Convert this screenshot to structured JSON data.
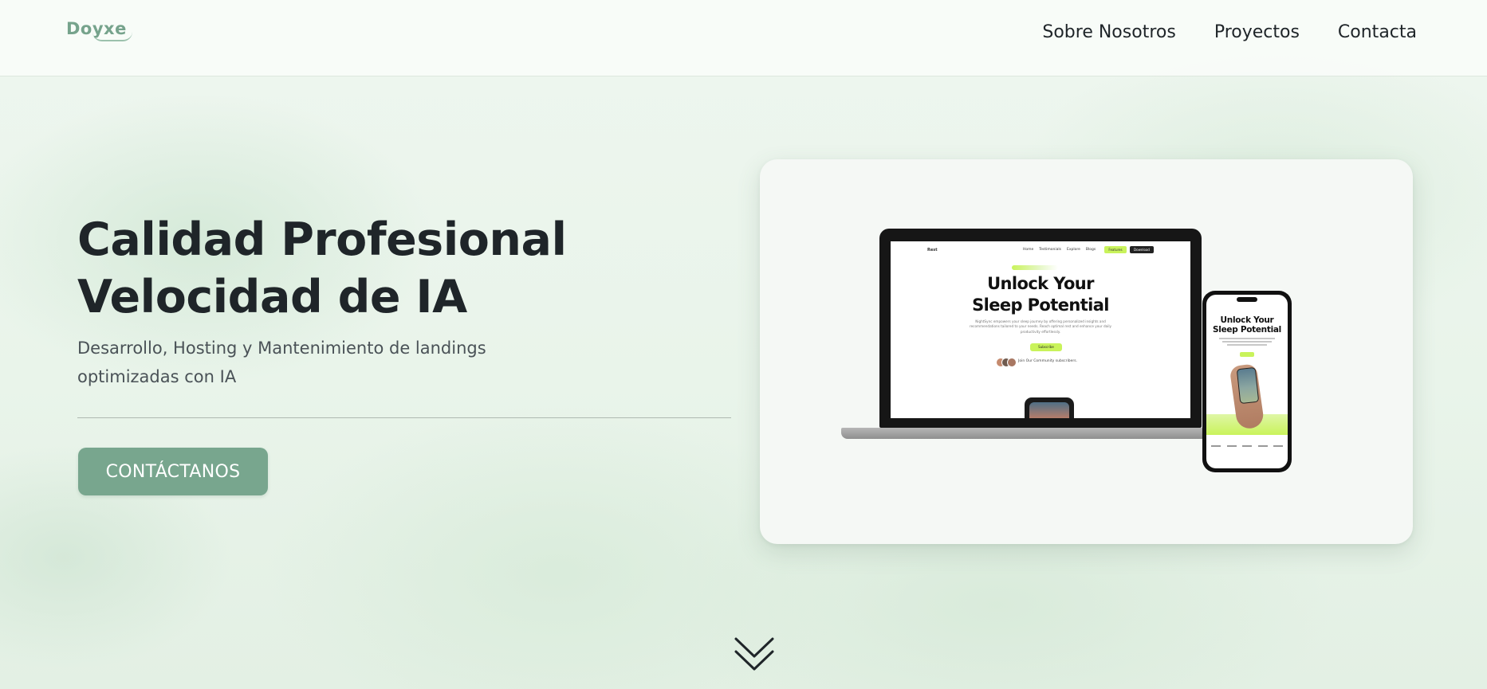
{
  "header": {
    "logo_text": "Doyxe",
    "nav": [
      {
        "label": "Sobre Nosotros"
      },
      {
        "label": "Proyectos"
      },
      {
        "label": "Contacta"
      }
    ]
  },
  "hero": {
    "title_line1": "Calidad Profesional",
    "title_line2": "Velocidad de IA",
    "subtitle": "Desarrollo, Hosting y Mantenimiento de landings optimizadas con IA",
    "cta_label": "CONTÁCTANOS"
  },
  "mockup": {
    "laptop_headline_line1": "Unlock Your",
    "laptop_headline_line2": "Sleep Potential",
    "phone_headline_line1": "Unlock Your",
    "phone_headline_line2": "Sleep Potential",
    "mini_nav_links": [
      "Home",
      "Testimonials",
      "Explore",
      "Blogs"
    ],
    "mini_logo": "Rest",
    "mini_features_label": "Features",
    "mini_download_label": "Download",
    "mini_paragraph": "NightSync empowers your sleep journey by offering personalized insights and recommendations tailored to your needs. Reach optimal rest and enhance your daily productivity effortlessly.",
    "mini_cta_label": "Subscribe",
    "mini_community": "Join Our Community subscribers."
  },
  "colors": {
    "accent": "#78a68e",
    "logo": "#76a38c",
    "text": "#1f2529",
    "mockup_highlight": "#c9f35b"
  },
  "icons": {
    "scroll_down": "double-chevron-down-icon"
  }
}
